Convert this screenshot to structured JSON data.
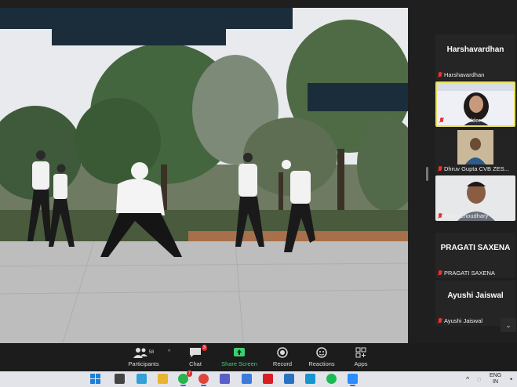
{
  "participants": [
    {
      "big_name": "Harshavardhan",
      "label": "Harshavardhan",
      "type": "name",
      "speaking": false
    },
    {
      "big_name": "",
      "label": "Trisha Halder",
      "type": "video-woman",
      "speaking": true
    },
    {
      "big_name": "",
      "label": "Dhruv Gupta CVB ZES...",
      "type": "video-man-1",
      "speaking": false
    },
    {
      "big_name": "",
      "label": "Rajat Choudhary",
      "type": "video-man-2",
      "speaking": false
    },
    {
      "big_name": "PRAGATI SAXENA",
      "label": "PRAGATI SAXENA",
      "type": "name",
      "speaking": false
    },
    {
      "big_name": "Ayushi Jaiswal",
      "label": "Ayushi Jaiswal",
      "type": "name",
      "speaking": false
    }
  ],
  "toolbar": {
    "participants_label": "Participants",
    "participants_count": "58",
    "chat_label": "Chat",
    "chat_badge": "3",
    "share_label": "Share Screen",
    "record_label": "Record",
    "reactions_label": "Reactions",
    "apps_label": "Apps"
  },
  "taskbar": {
    "lang_line1": "ENG",
    "lang_line2": "IN",
    "whatsapp_badge": "7"
  },
  "colors": {
    "share_green": "#3bd16f",
    "speaking_border": "#e8e060",
    "badge_red": "#e02a2a",
    "redaction_navy": "#1b2d3b"
  }
}
